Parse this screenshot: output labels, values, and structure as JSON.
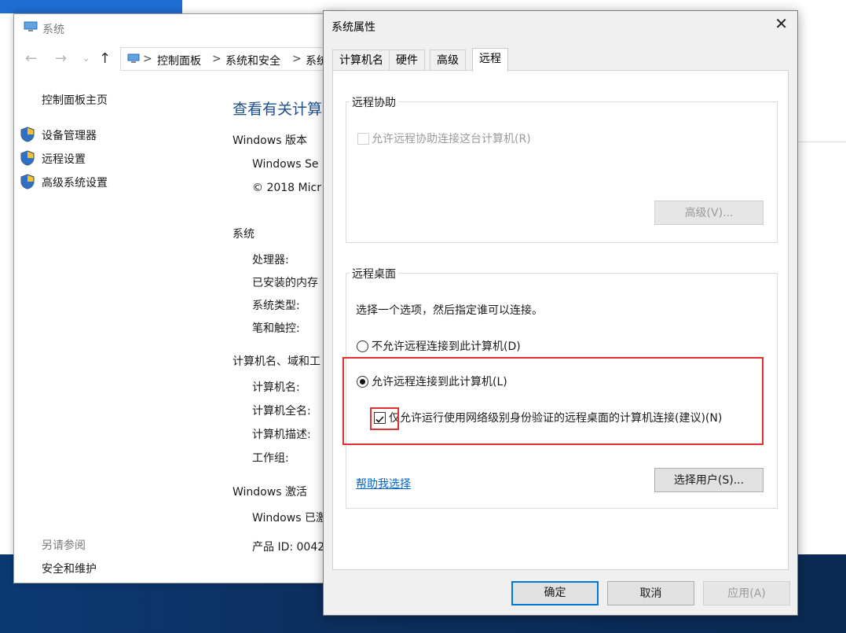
{
  "system_window": {
    "title": "系统",
    "address": {
      "crumbs": [
        "控制面板",
        "系统和安全",
        "系统"
      ],
      "separator": ">"
    },
    "sidebar": {
      "home": "控制面板主页",
      "links": [
        "设备管理器",
        "远程设置",
        "高级系统设置"
      ],
      "see_also_label": "另请参阅",
      "see_also_links": [
        "安全和维护"
      ]
    },
    "main": {
      "heading": "查看有关计算",
      "windows_edition_label": "Windows 版本",
      "edition_lines": [
        "Windows Se",
        "© 2018 Micr"
      ],
      "system_label": "系统",
      "system_items": [
        "处理器:",
        "已安装的内存",
        "系统类型:",
        "笔和触控:"
      ],
      "computer_label": "计算机名、域和工",
      "computer_items": [
        "计算机名:",
        "计算机全名:",
        "计算机描述:",
        "工作组:"
      ],
      "activation_label": "Windows 激活",
      "activation_lines": [
        "Windows 已激",
        "产品 ID: 0042"
      ]
    }
  },
  "dialog": {
    "title": "系统属性",
    "tabs": [
      "计算机名",
      "硬件",
      "高级",
      "远程"
    ],
    "active_tab": "远程",
    "remote_assistance": {
      "group_label": "远程协助",
      "allow_checkbox_label": "允许远程协助连接这台计算机(R)",
      "allow_checked": false,
      "advanced_button": "高级(V)..."
    },
    "remote_desktop": {
      "group_label": "远程桌面",
      "instruction": "选择一个选项，然后指定谁可以连接。",
      "option_deny": "不允许远程连接到此计算机(D)",
      "option_allow": "允许远程连接到此计算机(L)",
      "selected_option": "allow",
      "nla_checkbox_label": "仅允许运行使用网络级别身份验证的远程桌面的计算机连接(建议)(N)",
      "nla_checked": true,
      "help_link": "帮助我选择",
      "select_users_button": "选择用户(S)..."
    },
    "buttons": {
      "ok": "确定",
      "cancel": "取消",
      "apply": "应用(A)"
    }
  },
  "colors": {
    "highlight_box": "#e03030",
    "link": "#0066cc",
    "heading": "#1e4e8c"
  }
}
